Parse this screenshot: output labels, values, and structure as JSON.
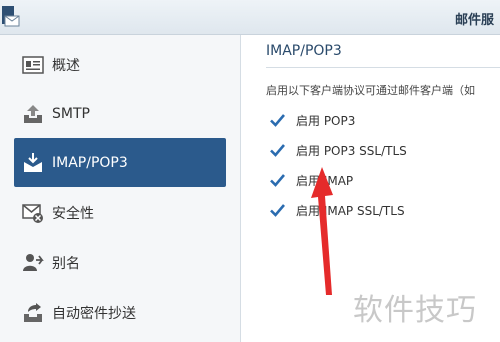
{
  "window": {
    "title": "邮件服"
  },
  "sidebar": {
    "items": [
      {
        "label": "概述",
        "icon": "overview-icon"
      },
      {
        "label": "SMTP",
        "icon": "upload-icon"
      },
      {
        "label": "IMAP/POP3",
        "icon": "download-mail-icon",
        "active": true
      },
      {
        "label": "安全性",
        "icon": "security-icon"
      },
      {
        "label": "别名",
        "icon": "alias-icon"
      },
      {
        "label": "自动密件抄送",
        "icon": "auto-bcc-icon"
      }
    ]
  },
  "main": {
    "section_title": "IMAP/POP3",
    "description": "启用以下客户端协议可通过邮件客户端（如",
    "options": [
      {
        "label": "启用 POP3",
        "checked": true
      },
      {
        "label": "启用 POP3 SSL/TLS",
        "checked": true
      },
      {
        "label": "启用 IMAP",
        "checked": true
      },
      {
        "label": "启用 IMAP SSL/TLS",
        "checked": true
      }
    ]
  },
  "watermark": "软件技巧",
  "colors": {
    "accent": "#2b5a8c",
    "arrow": "#e52b2b",
    "checkbox": "#2b6cb0"
  }
}
